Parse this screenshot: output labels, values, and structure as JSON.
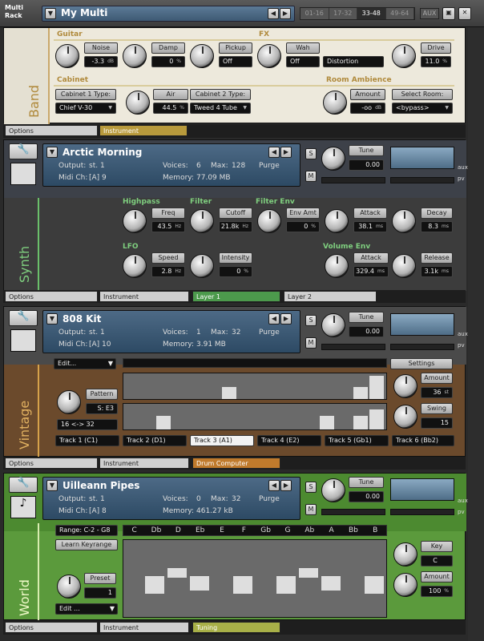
{
  "header": {
    "app_label": "Multi\nRack",
    "multi_name": "My Multi",
    "tabs": [
      "01-16",
      "17-32",
      "33-48",
      "49-64"
    ],
    "active_tab": "33-48",
    "aux": "AUX"
  },
  "band": {
    "side_label": "Band",
    "guitar": "Guitar",
    "fx": "FX",
    "cabinet": "Cabinet",
    "room": "Room Ambience",
    "knobs": [
      {
        "name": "Noise",
        "value": "-3.3",
        "unit": "dB"
      },
      {
        "name": "Damp",
        "value": "0",
        "unit": "%"
      },
      {
        "name": "Pickup",
        "value": "Off",
        "unit": ""
      },
      {
        "name": "Wah",
        "value": "Off",
        "unit": ""
      },
      {
        "name": "Drive",
        "value": "11.0",
        "unit": "%"
      },
      {
        "name": "Air",
        "value": "44.5",
        "unit": "%"
      },
      {
        "name": "Amount",
        "value": "-oo",
        "unit": "dB"
      }
    ],
    "distortion": "Distortion",
    "cab1_label": "Cabinet 1 Type:",
    "cab1_value": "Chief V-30",
    "cab2_label": "Cabinet 2 Type:",
    "cab2_value": "Tweed 4 Tube",
    "room_label": "Select Room:",
    "room_value": "<bypass>",
    "tab_options": "Options",
    "tab_instrument": "Instrument"
  },
  "synth": {
    "name": "Arctic Morning",
    "output": "st. 1",
    "midi": "[A]  9",
    "voices": "6",
    "max": "128",
    "memory": "77.09 MB",
    "purge": "Purge",
    "tune_label": "Tune",
    "tune_value": "0.00",
    "side_label": "Synth",
    "sections": {
      "highpass": "Highpass",
      "filter": "Filter",
      "filterenv": "Filter Env",
      "lfo": "LFO",
      "volenv": "Volume Env"
    },
    "knobs": [
      {
        "name": "Freq",
        "value": "43.5",
        "unit": "Hz"
      },
      {
        "name": "Cutoff",
        "value": "21.8k",
        "unit": "Hz"
      },
      {
        "name": "Env Amt",
        "value": "0",
        "unit": "%"
      },
      {
        "name": "Attack",
        "value": "38.1",
        "unit": "ms"
      },
      {
        "name": "Decay",
        "value": "8.3",
        "unit": "ms"
      },
      {
        "name": "Speed",
        "value": "2.8",
        "unit": "Hz"
      },
      {
        "name": "Intensity",
        "value": "0",
        "unit": "%"
      },
      {
        "name": "Attack",
        "value": "329.4",
        "unit": "ms"
      },
      {
        "name": "Release",
        "value": "3.1k",
        "unit": "ms"
      }
    ],
    "tabs": [
      "Options",
      "Instrument",
      "Layer 1",
      "Layer 2"
    ]
  },
  "vintage": {
    "name": "808 Kit",
    "output": "st. 1",
    "midi": "[A]  10",
    "voices": "1",
    "max": "32",
    "memory": "3.91 MB",
    "purge": "Purge",
    "tune_label": "Tune",
    "tune_value": "0.00",
    "side_label": "Vintage",
    "edit": "Edit...",
    "settings": "Settings",
    "pattern_label": "Pattern",
    "pattern_value": "S: E3",
    "range": "16  <->  32",
    "amount_label": "Amount",
    "amount_value": "36",
    "amount_unit": "st",
    "swing_label": "Swing",
    "swing_value": "15",
    "tracks": [
      "Track 1  (C1)",
      "Track 2  (D1)",
      "Track 3  (A1)",
      "Track 4  (E2)",
      "Track 5  (Gb1)",
      "Track 6  (Bb2)"
    ],
    "tabs": [
      "Options",
      "Instrument",
      "Drum Computer"
    ]
  },
  "world": {
    "name": "Uilleann Pipes",
    "output": "st. 1",
    "midi": "[A]  8",
    "voices": "0",
    "max": "32",
    "memory": "461.27 kB",
    "purge": "Purge",
    "tune_label": "Tune",
    "tune_value": "0.00",
    "side_label": "World",
    "range": "Range:  C-2  -  G8",
    "learn": "Learn Keyrange",
    "notes": [
      "C",
      "Db",
      "D",
      "Eb",
      "E",
      "F",
      "Gb",
      "G",
      "Ab",
      "A",
      "Bb",
      "B"
    ],
    "preset_label": "Preset",
    "preset_value": "1",
    "edit": "Edit ...",
    "key_label": "Key",
    "key_value": "C",
    "amount_label": "Amount",
    "amount_value": "100",
    "amount_unit": "%",
    "tabs": [
      "Options",
      "Instrument",
      "Tuning"
    ]
  },
  "common": {
    "output_label": "Output:",
    "midi_label": "Midi Ch:",
    "voices_label": "Voices:",
    "max_label": "Max:",
    "memory_label": "Memory:",
    "s": "S",
    "m": "M",
    "aux": "aux",
    "pv": "pv"
  }
}
